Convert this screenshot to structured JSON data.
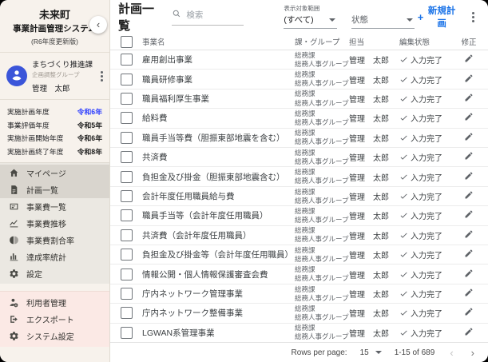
{
  "colors": {
    "accent_blue": "#1a73e8",
    "year_highlight_blue": "#2b3cff",
    "avatar_blue": "#3b55d9",
    "sidebar_cream": "#f7f2ec",
    "sidebar_menu_bg": "#ebe8e2",
    "sidebar_selected_bg": "#d9d5ce",
    "admin_section_pink": "#fbe9e5",
    "text_primary": "#3c4043",
    "text_secondary": "#5f6368"
  },
  "icon_glyphs": {
    "chevron-left": "‹",
    "chevron-right": "›"
  },
  "sidebar": {
    "title_line1": "未来町",
    "title_line2": "事業計画管理システム",
    "subtitle": "(R6年度更新版)",
    "user": {
      "department": "まちづくり推進課",
      "group": "企画調整グループ",
      "name": "管理　太郎"
    },
    "years": [
      {
        "label": "実施計画年度",
        "value": "令和6年",
        "value_highlight": true
      },
      {
        "label": "事業評価年度",
        "value": "令和5年"
      },
      {
        "label": "実施計画開始年度",
        "value": "令和6年"
      },
      {
        "label": "実施計画終了年度",
        "value": "令和8年"
      }
    ],
    "menu": [
      {
        "label": "マイページ",
        "icon": "home",
        "highlighted": true
      },
      {
        "label": "計画一覧",
        "icon": "document",
        "selected": true
      },
      {
        "label": "事業費一覧",
        "icon": "card"
      },
      {
        "label": "事業費推移",
        "icon": "line-chart"
      },
      {
        "label": "事業費割合率",
        "icon": "pie-chart"
      },
      {
        "label": "達成率統計",
        "icon": "bar-chart"
      },
      {
        "label": "設定",
        "icon": "gear"
      }
    ],
    "admin_menu": [
      {
        "label": "利用者管理",
        "icon": "user-gear"
      },
      {
        "label": "エクスポート",
        "icon": "export"
      },
      {
        "label": "システム設定",
        "icon": "gear"
      }
    ]
  },
  "header": {
    "title": "計画一覧",
    "search_placeholder": "検索",
    "scope_label": "表示対象範囲",
    "scope_value": "(すべて)",
    "status_placeholder": "状態",
    "new_plan_plus": "+",
    "new_plan_label": "新規計画"
  },
  "table": {
    "columns": [
      "事業名",
      "課・グループ",
      "担当",
      "編集状態",
      "修正"
    ],
    "rows": [
      {
        "name": "雇用創出事業",
        "section": "総務課",
        "group": "総務人事グループ",
        "owner": "管理　太郎",
        "status": "入力完了"
      },
      {
        "name": "職員研修事業",
        "section": "総務課",
        "group": "総務人事グループ",
        "owner": "管理　太郎",
        "status": "入力完了"
      },
      {
        "name": "職員福利厚生事業",
        "section": "総務課",
        "group": "総務人事グループ",
        "owner": "管理　太郎",
        "status": "入力完了"
      },
      {
        "name": "給料費",
        "section": "総務課",
        "group": "総務人事グループ",
        "owner": "管理　太郎",
        "status": "入力完了"
      },
      {
        "name": "職員手当等費（胆振東部地震を含む）",
        "section": "総務課",
        "group": "総務人事グループ",
        "owner": "管理　太郎",
        "status": "入力完了"
      },
      {
        "name": "共済費",
        "section": "総務課",
        "group": "総務人事グループ",
        "owner": "管理　太郎",
        "status": "入力完了"
      },
      {
        "name": "負担金及び掛金（胆振東部地震含む）",
        "section": "総務課",
        "group": "総務人事グループ",
        "owner": "管理　太郎",
        "status": "入力完了"
      },
      {
        "name": "会計年度任用職員給与費",
        "section": "総務課",
        "group": "総務人事グループ",
        "owner": "管理　太郎",
        "status": "入力完了"
      },
      {
        "name": "職員手当等（会計年度任用職員）",
        "section": "総務課",
        "group": "総務人事グループ",
        "owner": "管理　太郎",
        "status": "入力完了"
      },
      {
        "name": "共済費（会計年度任用職員）",
        "section": "総務課",
        "group": "総務人事グループ",
        "owner": "管理　太郎",
        "status": "入力完了"
      },
      {
        "name": "負担金及び掛金等（会計年度任用職員）",
        "section": "総務課",
        "group": "総務人事グループ",
        "owner": "管理　太郎",
        "status": "入力完了"
      },
      {
        "name": "情報公開・個人情報保護審査会費",
        "section": "総務課",
        "group": "総務人事グループ",
        "owner": "管理　太郎",
        "status": "入力完了"
      },
      {
        "name": "庁内ネットワーク管理事業",
        "section": "総務課",
        "group": "総務人事グループ",
        "owner": "管理　太郎",
        "status": "入力完了"
      },
      {
        "name": "庁内ネットワーク整備事業",
        "section": "総務課",
        "group": "総務人事グループ",
        "owner": "管理　太郎",
        "status": "入力完了"
      },
      {
        "name": "LGWAN系管理事業",
        "section": "総務課",
        "group": "総務人事グループ",
        "owner": "管理　太郎",
        "status": "入力完了"
      }
    ]
  },
  "footer": {
    "rows_per_page_label": "Rows per page:",
    "rows_per_page_value": "15",
    "range_label": "1-15 of 689"
  }
}
